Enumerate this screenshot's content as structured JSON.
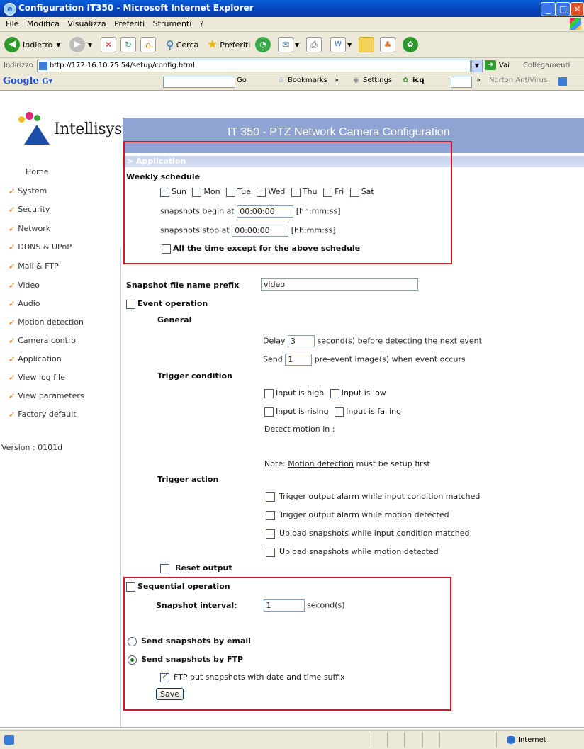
{
  "window": {
    "title": "Configuration IT350 - Microsoft Internet Explorer"
  },
  "menu": [
    "File",
    "Modifica",
    "Visualizza",
    "Preferiti",
    "Strumenti",
    "?"
  ],
  "toolbar": {
    "back": "Indietro",
    "search": "Cerca",
    "favorites": "Preferiti"
  },
  "address": {
    "label": "Indirizzo",
    "url": "http://172.16.10.75:54/setup/config.html",
    "go": "Vai",
    "links": "Collegamenti"
  },
  "googlebar": {
    "logo": "Google",
    "go": "Go",
    "bookmarks": "Bookmarks",
    "settings": "Settings",
    "icq": "icq",
    "norton": "Norton AntiVirus"
  },
  "brand": {
    "logo": "Intellisystem",
    "header": "IT 350 - PTZ Network Camera Configuration",
    "section": "> Application"
  },
  "sidebar": {
    "home": "Home",
    "items": [
      "System",
      "Security",
      "Network",
      "DDNS & UPnP",
      "Mail & FTP",
      "Video",
      "Audio",
      "Motion detection",
      "Camera control",
      "Application",
      "View log file",
      "View parameters",
      "Factory default"
    ],
    "version": "Version : 0101d"
  },
  "schedule": {
    "title": "Weekly schedule",
    "days": [
      "Sun",
      "Mon",
      "Tue",
      "Wed",
      "Thu",
      "Fri",
      "Sat"
    ],
    "begin_label": "snapshots begin at",
    "begin_value": "00:00:00",
    "stop_label": "snapshots stop at",
    "stop_value": "00:00:00",
    "format": "[hh:mm:ss]",
    "except": "All the time except for the above schedule"
  },
  "prefix": {
    "label": "Snapshot file name prefix",
    "value": "video"
  },
  "event": {
    "title": "Event operation",
    "general": "General",
    "delay_pre": "Delay",
    "delay_value": "3",
    "delay_post": "second(s) before detecting the next event",
    "send_pre": "Send",
    "send_value": "1",
    "send_post": "pre-event image(s) when event occurs",
    "trigger_condition": "Trigger condition",
    "input_high": "Input is high",
    "input_low": "Input is low",
    "input_rising": "Input is rising",
    "input_falling": "Input is falling",
    "detect_motion": "Detect motion in :",
    "note_pre": "Note:",
    "note_link": "Motion detection",
    "note_post": "must be setup first",
    "trigger_action": "Trigger action",
    "actions": [
      "Trigger output alarm while input condition matched",
      "Trigger output alarm while motion detected",
      "Upload snapshots while input condition matched",
      "Upload snapshots while motion detected"
    ],
    "reset": "Reset output"
  },
  "sequential": {
    "title": "Sequential operation",
    "interval_label": "Snapshot interval:",
    "interval_value": "1",
    "interval_unit": "second(s)",
    "email": "Send snapshots by email",
    "ftp": "Send snapshots by FTP",
    "ftp_suffix": "FTP put snapshots with date and time suffix",
    "save": "Save"
  },
  "status": {
    "zone": "Internet"
  }
}
